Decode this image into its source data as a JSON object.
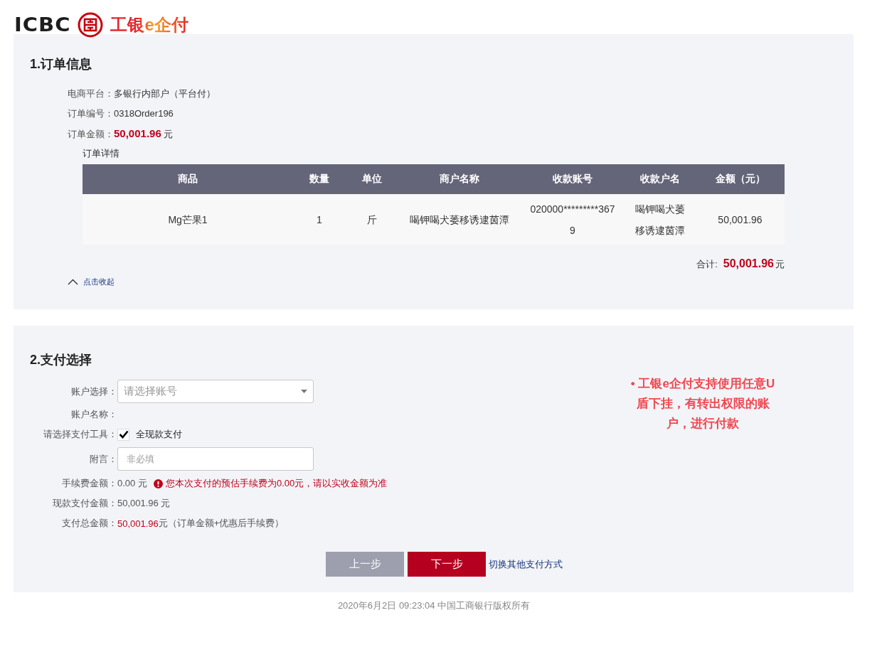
{
  "header": {
    "brand": "ICBC",
    "product_name": "工银e企付"
  },
  "order_section": {
    "title": "1.订单信息",
    "fields": [
      {
        "kind": "text",
        "label": "电商平台：",
        "value": "多银行内部户（平台付）"
      },
      {
        "kind": "text",
        "label": "订单编号：",
        "value": "0318Order196"
      },
      {
        "kind": "amount",
        "label": "订单金额：",
        "value": "50,001.96",
        "unit": "元"
      }
    ],
    "details_label": "订单详情",
    "table": {
      "columns": [
        "商品",
        "数量",
        "单位",
        "商户名称",
        "收款账号",
        "收款户名",
        "金额（元）"
      ],
      "rows": [
        {
          "cells": [
            "Mg芒果1",
            "1",
            "斤",
            "喝钾喝犬萎移诱逮茵潭",
            "020000*********3679",
            "喝钾喝犬萎移诱逮茵潭",
            "50,001.96"
          ]
        }
      ]
    },
    "total": {
      "label": "合计:",
      "amount": "50,001.96",
      "unit": "元"
    },
    "collapse_link": "点击收起"
  },
  "payment_section": {
    "title": "2.支付选择",
    "fields": [
      {
        "kind": "select",
        "label": "账户选择：",
        "placeholder": "请选择账号"
      },
      {
        "kind": "text",
        "label": "账户名称："
      },
      {
        "kind": "checkbox",
        "label": "请选择支付工具：",
        "option": "全现款支付",
        "checked": true
      },
      {
        "kind": "input",
        "label": "附言：",
        "placeholder": "非必填"
      },
      {
        "kind": "fee",
        "label": "手续费金额：",
        "value": "0.00 元",
        "notice": "您本次支付的预估手续费为0.00元，请以实收金额为准"
      },
      {
        "kind": "text",
        "label": "现款支付金额：",
        "value": "50,001.96 元"
      },
      {
        "kind": "total",
        "label": "支付总金额：",
        "value": "50,001.96",
        "note": "元（订单金额+优惠后手续费）"
      }
    ],
    "buttons": [
      {
        "label": "上一步",
        "disabled": true
      },
      {
        "label": "下一步",
        "disabled": false
      }
    ],
    "switch_link": "切换其他支付方式",
    "notice": "• 工银e企付支持使用任意U盾下挂，有转出权限的账户，进行付款"
  },
  "footer": "2020年6月2日 09:23:04 中国工商银行版权所有"
}
